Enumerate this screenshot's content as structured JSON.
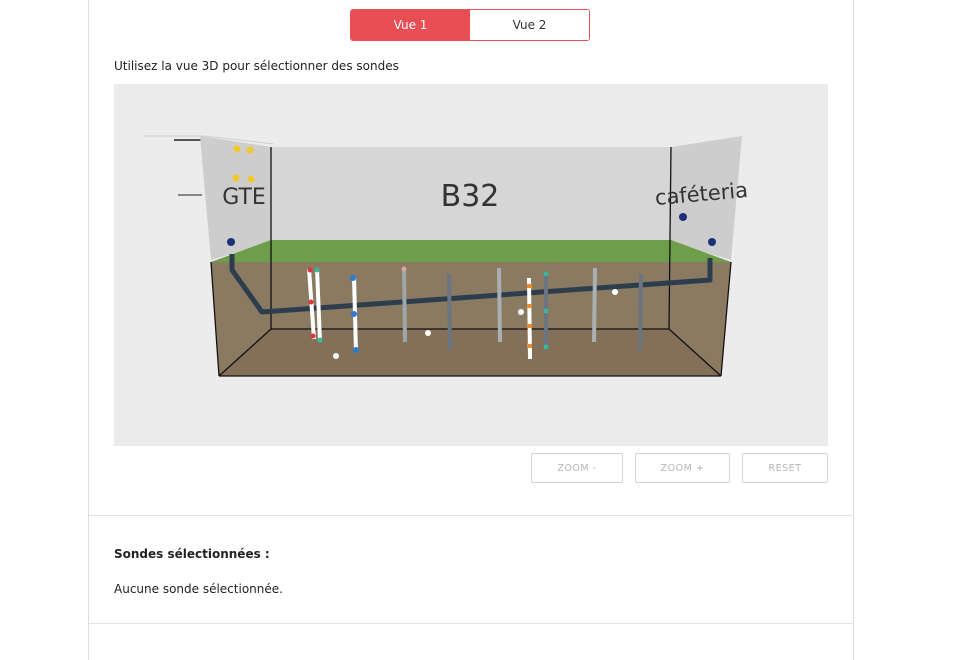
{
  "tabs": [
    {
      "label": "Vue 1",
      "active": true
    },
    {
      "label": "Vue 2",
      "active": false
    }
  ],
  "instruction": "Utilisez la vue 3D pour sélectionner des sondes",
  "viewer": {
    "room_label": "B32",
    "left_wall_label": "GTE",
    "right_wall_label": "caféteria"
  },
  "controls": {
    "zoom_out": "ZOOM -",
    "zoom_in": "ZOOM +",
    "reset": "RESET"
  },
  "selection": {
    "title": "Sondes sélectionnées :",
    "empty_message": "Aucune sonde sélectionnée."
  },
  "colors": {
    "accent": "#ea4e55",
    "grass": "#6e9e4a",
    "soil": "#8a7a62",
    "pipe": "#2c3e4e"
  }
}
